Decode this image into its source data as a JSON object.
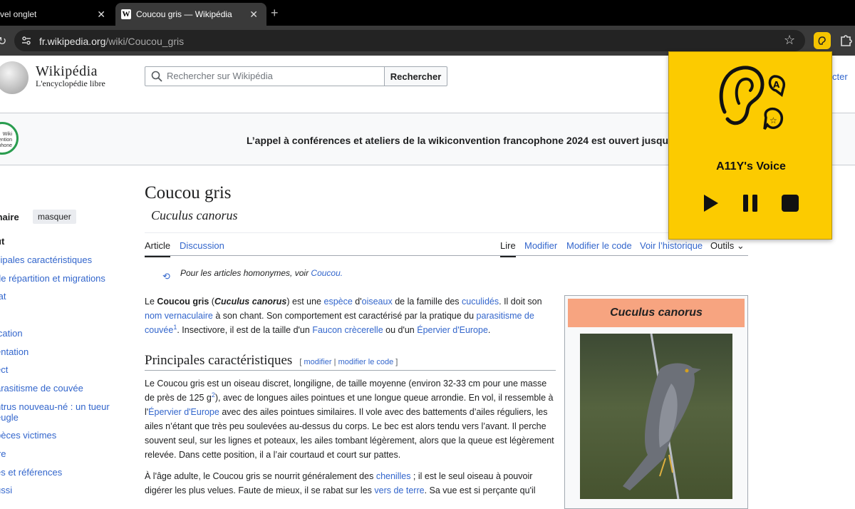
{
  "browser": {
    "tabs": [
      {
        "title": "vel onglet"
      },
      {
        "title": "Coucou gris — Wikipédia",
        "favicon": "W"
      }
    ],
    "url_host": "fr.wikipedia.org",
    "url_path": "/wiki/Coucou_gris",
    "extension_icon": "A11Y"
  },
  "wiki": {
    "logo_title": "Wikipédia",
    "logo_tagline": "L'encyclopédie libre",
    "search_placeholder": "Rechercher sur Wikipédia",
    "search_button": "Rechercher",
    "connect_label": "cter"
  },
  "banner": {
    "logo_text": "Wiki vention ncophone",
    "text": "L’appel à conférences et ateliers de la wikiconvention francophone 2024 est ouvert jusqu’a"
  },
  "sidebar": {
    "title": "maire",
    "hide_button": "masquer",
    "items": [
      "ut",
      "cipales caractéristiques",
      "de répartition et migrations",
      "tat",
      "ication",
      "entation",
      "ect",
      "arasitisme de couvée",
      "ntrus nouveau-né : un tueur",
      "eugle",
      "pèces victimes",
      "ire",
      "es et références",
      "ussi"
    ]
  },
  "article": {
    "title": "Coucou gris",
    "latin_name": "Cuculus canorus",
    "tabs": {
      "article": "Article",
      "discussion": "Discussion",
      "read": "Lire",
      "edit": "Modifier",
      "edit_source": "Modifier le code",
      "history": "Voir l’historique",
      "tools": "Outils"
    },
    "hatnote_prefix": "Pour les articles homonymes, voir ",
    "hatnote_link": "Coucou.",
    "intro": {
      "t1": "Le ",
      "b1": "Coucou gris",
      "t2": " (",
      "bi1": "Cuculus canorus",
      "t3": ") est une ",
      "l1": "espèce",
      "t4": " d'",
      "l2": "oiseaux",
      "t5": " de la famille des ",
      "l3": "cuculidés",
      "t6": ". Il doit son ",
      "l4": "nom vernaculaire",
      "t7": " à son chant. Son comportement est caractérisé par la pratique du ",
      "l5": "parasitisme de couvée",
      "sup": "1",
      "t8": ". Insectivore, il est de la taille d'un ",
      "l6": "Faucon crècerelle",
      "t9": " ou d'un ",
      "l7": "Épervier d'Europe",
      "t10": "."
    },
    "section_title": "Principales caractéristiques",
    "section_edit_open": "[ ",
    "section_edit": "modifier",
    "section_edit_sep": " | ",
    "section_edit_code": "modifier le code",
    "section_edit_close": " ]",
    "p2": {
      "t1": "Le Coucou gris est un oiseau discret, longiligne, de taille moyenne (environ 32-33 cm pour une masse de près de 125 g",
      "sup": "2",
      "t2": "), avec de longues ailes pointues et une longue queue arrondie. En vol, il ressemble à l'",
      "l1": "Épervier d'Europe",
      "t3": " avec des ailes pointues similaires. Il vole avec des battements d’ailes réguliers, les ailes n’étant que très peu soulevées au-dessus du corps. Le bec est alors tendu vers l’avant. Il perche souvent seul, sur les lignes et poteaux, les ailes tombant légèrement, alors que la queue est légèrement relevée. Dans cette position, il a l’air courtaud et court sur pattes."
    },
    "p3": {
      "t1": "À l'âge adulte, le Coucou gris se nourrit généralement des ",
      "l1": "chenilles",
      "t2": " ; il est le seul oiseau à pouvoir digérer les plus velues. Faute de mieux, il se rabat sur les ",
      "l2": "vers de terre",
      "t3": ". Sa vue est si perçante qu'il"
    },
    "infobox_title": "Cuculus canorus"
  },
  "extension": {
    "title": "A11Y's Voice",
    "color": "#fccb00"
  }
}
